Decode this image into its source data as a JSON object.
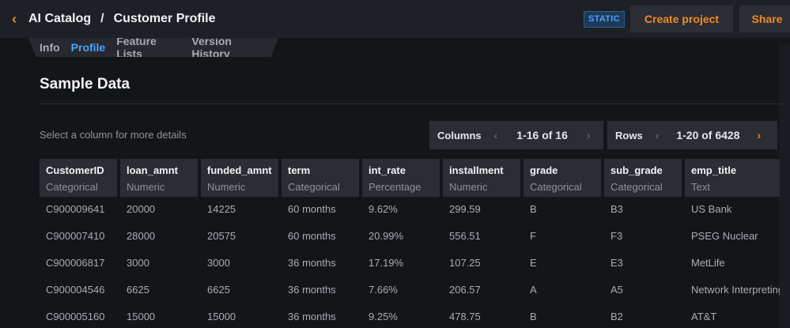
{
  "header": {
    "breadcrumb": [
      "AI Catalog",
      "Customer Profile"
    ],
    "separator": "/",
    "badge": "STATIC",
    "create_label": "Create project",
    "share_label": "Share"
  },
  "tabs": [
    "Info",
    "Profile",
    "Feature Lists",
    "Version History"
  ],
  "active_tab": "Profile",
  "section": {
    "title": "Sample Data",
    "hint": "Select a column for more details"
  },
  "pager": {
    "columns_label": "Columns",
    "columns_range": "1-16 of 16",
    "rows_label": "Rows",
    "rows_range": "1-20 of 6428"
  },
  "table": {
    "columns": [
      {
        "name": "CustomerID",
        "type": "Categorical"
      },
      {
        "name": "loan_amnt",
        "type": "Numeric"
      },
      {
        "name": "funded_amnt",
        "type": "Numeric"
      },
      {
        "name": "term",
        "type": "Categorical"
      },
      {
        "name": "int_rate",
        "type": "Percentage"
      },
      {
        "name": "installment",
        "type": "Numeric"
      },
      {
        "name": "grade",
        "type": "Categorical"
      },
      {
        "name": "sub_grade",
        "type": "Categorical"
      },
      {
        "name": "emp_title",
        "type": "Text"
      }
    ],
    "rows": [
      [
        "C900009641",
        "20000",
        "14225",
        "60 months",
        "9.62%",
        "299.59",
        "B",
        "B3",
        "US Bank"
      ],
      [
        "C900007410",
        "28000",
        "20575",
        "60 months",
        "20.99%",
        "556.51",
        "F",
        "F3",
        "PSEG Nuclear"
      ],
      [
        "C900006817",
        "3000",
        "3000",
        "36 months",
        "17.19%",
        "107.25",
        "E",
        "E3",
        "MetLife"
      ],
      [
        "C900004546",
        "6625",
        "6625",
        "36 months",
        "7.66%",
        "206.57",
        "A",
        "A5",
        "Network Interpreting"
      ],
      [
        "C900005160",
        "15000",
        "15000",
        "36 months",
        "9.25%",
        "478.75",
        "B",
        "B2",
        "AT&T"
      ]
    ]
  },
  "colors": {
    "accent": "#f08a24",
    "link": "#4aa3ff",
    "background": "#141519"
  }
}
